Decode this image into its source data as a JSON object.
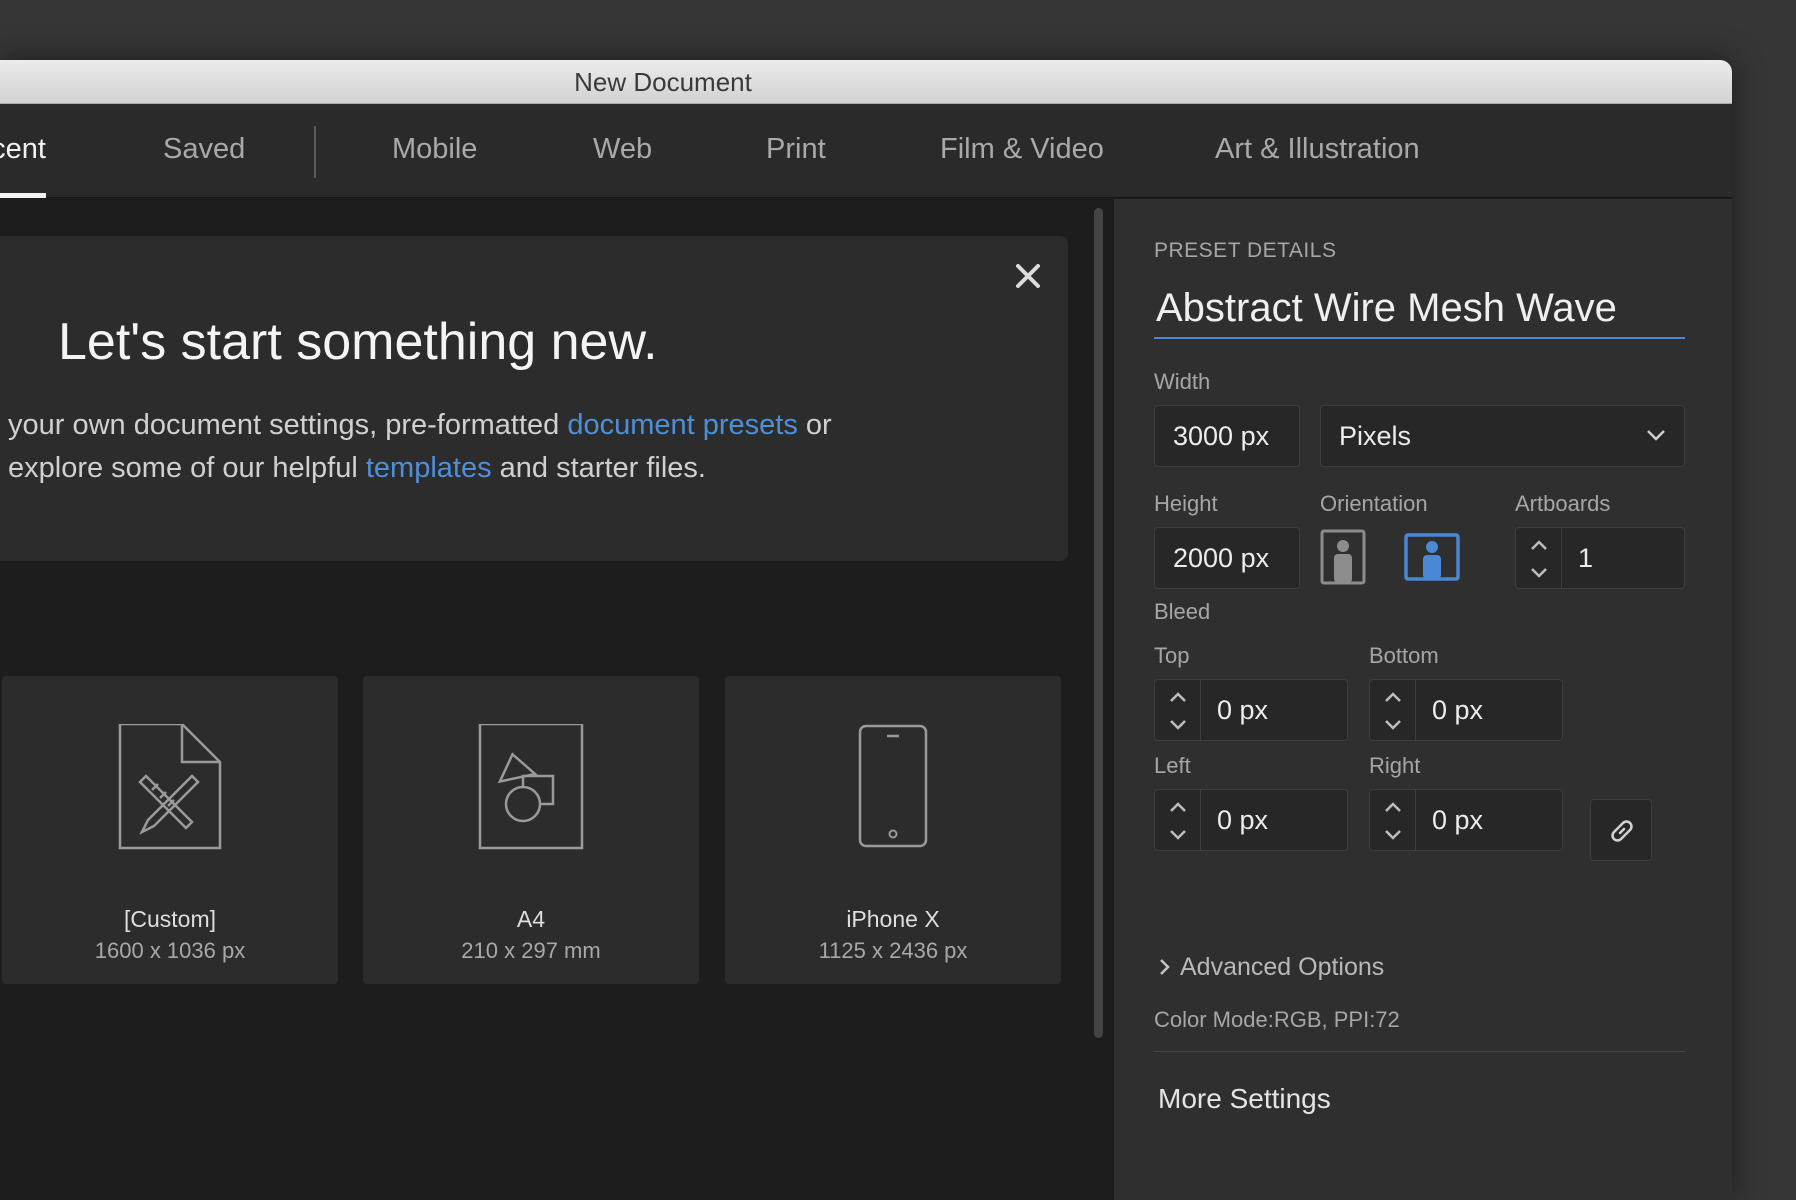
{
  "window": {
    "title": "New Document"
  },
  "tabs": [
    {
      "label": "Recent",
      "active": true
    },
    {
      "label": "Saved"
    },
    {
      "label": "Mobile"
    },
    {
      "label": "Web"
    },
    {
      "label": "Print"
    },
    {
      "label": "Film & Video"
    },
    {
      "label": "Art & Illustration"
    }
  ],
  "welcome": {
    "heading": "Let's start something new.",
    "line1_pre": "your own document settings, pre-formatted ",
    "link_presets": "document presets",
    "line1_post": " or",
    "line2_pre": "explore some of our helpful ",
    "link_templates": "templates",
    "line2_post": " and starter files."
  },
  "presets": [
    {
      "name": "[Custom]",
      "size": "1600 x 1036 px",
      "icon": "custom-document-icon"
    },
    {
      "name": "A4",
      "size": "210 x 297 mm",
      "icon": "print-document-icon"
    },
    {
      "name": "iPhone X",
      "size": "1125 x 2436 px",
      "icon": "phone-icon"
    }
  ],
  "details": {
    "section_title": "PRESET DETAILS",
    "preset_name": "Abstract Wire Mesh Wave",
    "width_label": "Width",
    "width_value": "3000 px",
    "units": "Pixels",
    "height_label": "Height",
    "height_value": "2000 px",
    "orientation_label": "Orientation",
    "orientation": "landscape",
    "artboards_label": "Artboards",
    "artboards_value": "1",
    "bleed_label": "Bleed",
    "top_label": "Top",
    "top_value": "0 px",
    "bottom_label": "Bottom",
    "bottom_value": "0 px",
    "left_label": "Left",
    "left_value": "0 px",
    "right_label": "Right",
    "right_value": "0 px",
    "advanced_label": "Advanced Options",
    "color_mode": "Color Mode:RGB, PPI:72",
    "more_settings": "More Settings"
  },
  "colors": {
    "accent": "#4a87d4",
    "link": "#4d8fd9"
  }
}
